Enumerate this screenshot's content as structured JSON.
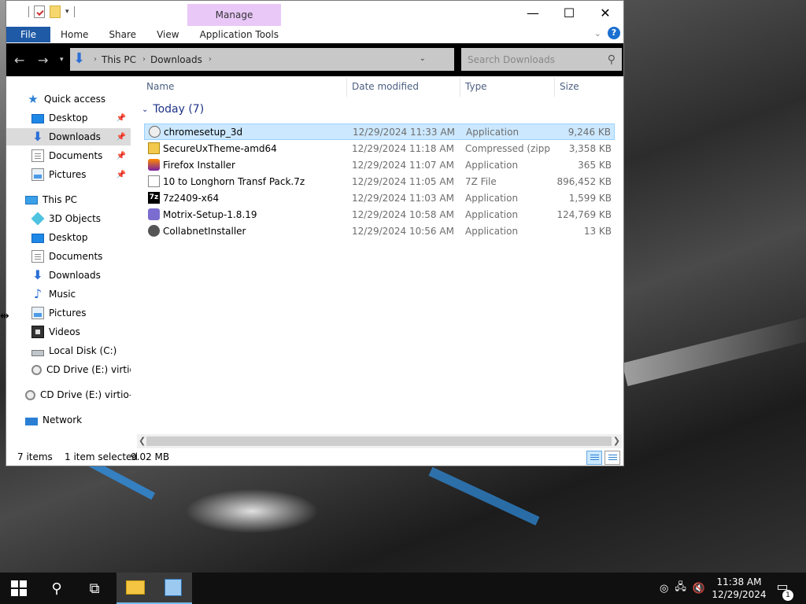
{
  "window": {
    "manage_tab": "Manage",
    "ribbon_tabs": [
      "File",
      "Home",
      "Share",
      "View",
      "Application Tools"
    ],
    "help_label": "?"
  },
  "navbar": {
    "breadcrumb": [
      "This PC",
      "Downloads"
    ],
    "search_placeholder": "Search Downloads"
  },
  "sidebar": {
    "quick_access": {
      "label": "Quick access",
      "items": [
        {
          "label": "Desktop",
          "icon": "desktop-icon",
          "pinned": true
        },
        {
          "label": "Downloads",
          "icon": "downloads-icon",
          "pinned": true,
          "selected": true
        },
        {
          "label": "Documents",
          "icon": "documents-icon",
          "pinned": true
        },
        {
          "label": "Pictures",
          "icon": "pictures-icon",
          "pinned": true
        }
      ]
    },
    "this_pc": {
      "label": "This PC",
      "items": [
        {
          "label": "3D Objects",
          "icon": "3d-objects-icon"
        },
        {
          "label": "Desktop",
          "icon": "desktop-icon"
        },
        {
          "label": "Documents",
          "icon": "documents-icon"
        },
        {
          "label": "Downloads",
          "icon": "downloads-icon"
        },
        {
          "label": "Music",
          "icon": "music-icon"
        },
        {
          "label": "Pictures",
          "icon": "pictures-icon"
        },
        {
          "label": "Videos",
          "icon": "videos-icon"
        },
        {
          "label": "Local Disk (C:)",
          "icon": "local-disk-icon"
        },
        {
          "label": "CD Drive (E:) virtio-w",
          "icon": "cd-drive-icon"
        }
      ]
    },
    "cd_drive": {
      "label": "CD Drive (E:) virtio-w"
    },
    "network": {
      "label": "Network"
    }
  },
  "list": {
    "columns": [
      "Name",
      "Date modified",
      "Type",
      "Size"
    ],
    "group_label": "Today (7)",
    "files": [
      {
        "name": "chromesetup_3d",
        "date": "12/29/2024 11:33 AM",
        "type": "Application",
        "size": "9,246 KB",
        "icon": "application-icon",
        "selected": true
      },
      {
        "name": "SecureUxTheme-amd64",
        "date": "12/29/2024 11:18 AM",
        "type": "Compressed (zipp...",
        "size": "3,358 KB",
        "icon": "zip-folder-icon"
      },
      {
        "name": "Firefox Installer",
        "date": "12/29/2024 11:07 AM",
        "type": "Application",
        "size": "365 KB",
        "icon": "firefox-icon"
      },
      {
        "name": "10 to Longhorn Transf Pack.7z",
        "date": "12/29/2024 11:05 AM",
        "type": "7Z File",
        "size": "896,452 KB",
        "icon": "file-icon"
      },
      {
        "name": "7z2409-x64",
        "date": "12/29/2024 11:03 AM",
        "type": "Application",
        "size": "1,599 KB",
        "icon": "7zip-icon"
      },
      {
        "name": "Motrix-Setup-1.8.19",
        "date": "12/29/2024 10:58 AM",
        "type": "Application",
        "size": "124,769 KB",
        "icon": "motrix-icon"
      },
      {
        "name": "CollabnetInstaller",
        "date": "12/29/2024 10:56 AM",
        "type": "Application",
        "size": "13 KB",
        "icon": "installer-icon"
      }
    ]
  },
  "status": {
    "item_count": "7 items",
    "selection": "1 item selected",
    "selection_size": "9.02 MB"
  },
  "taskbar": {
    "time": "11:38 AM",
    "date": "12/29/2024",
    "notification_count": "1"
  },
  "colors": {
    "accent": "#1f5aa6",
    "selection": "#cce8ff",
    "manage_tab": "#e9c8f8"
  }
}
